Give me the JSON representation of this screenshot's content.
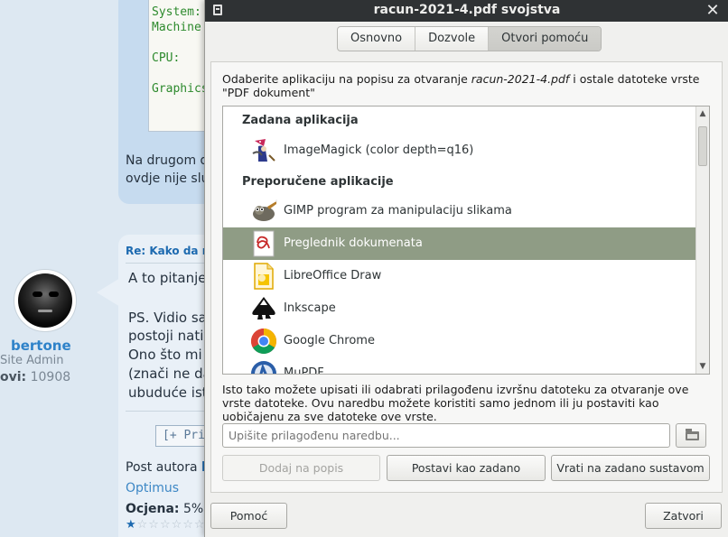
{
  "background": {
    "code_lines": [
      "System:",
      "Machine",
      "CPU:",
      "Graphics"
    ],
    "post1_lines": [
      "Na drugom di",
      "ovdje nije sluč"
    ],
    "post2_title": "Re: Kako da na",
    "post2_lines": [
      "A to pitanje",
      "PS. Vidio sa",
      "postoji nativ",
      "Ono što mi",
      "(znači ne da",
      "ubuduće ist"
    ],
    "pri_button": "[+ Pri",
    "post_author_label": "Post autora",
    "post_author_name": "b",
    "optimus": "Optimus",
    "ocjena_label": "Ocjena:",
    "ocjena_value": "5%",
    "user": {
      "name": "bertone",
      "role": "Site Admin",
      "posts_label": "ovi:",
      "posts_value": "10908"
    }
  },
  "dialog": {
    "title": "racun-2021-4.pdf svojstva",
    "tabs": [
      {
        "label": "Osnovno",
        "active": false
      },
      {
        "label": "Dozvole",
        "active": false
      },
      {
        "label": "Otvori pomoću",
        "active": true
      }
    ],
    "description_prefix": "Odaberite aplikaciju na popisu za otvaranje ",
    "description_file": "racun-2021-4.pdf",
    "description_suffix": " i ostale datoteke vrste \"PDF dokument\"",
    "default_heading": "Zadana aplikacija",
    "recommended_heading": "Preporučene aplikacije",
    "default_app": {
      "label": "ImageMagick (color depth=q16)",
      "icon": "imagemagick-icon"
    },
    "apps": [
      {
        "label": "GIMP program za manipulaciju slikama",
        "icon": "gimp-icon",
        "selected": false
      },
      {
        "label": "Preglednik dokumenata",
        "icon": "document-viewer-icon",
        "selected": true
      },
      {
        "label": "LibreOffice Draw",
        "icon": "libreoffice-draw-icon",
        "selected": false
      },
      {
        "label": "Inkscape",
        "icon": "inkscape-icon",
        "selected": false
      },
      {
        "label": "Google Chrome",
        "icon": "google-chrome-icon",
        "selected": false
      },
      {
        "label": "MuPDF",
        "icon": "mupdf-icon",
        "selected": false
      }
    ],
    "hint": "Isto tako možete upisati ili odabrati prilagođenu izvršnu datoteku za otvaranje ove vrste datoteke.  Ovu naredbu možete koristiti samo jednom ili ju postaviti kao uobičajenu za sve datoteke ove vrste.",
    "command_placeholder": "Upišite prilagođenu naredbu...",
    "buttons": {
      "add": "Dodaj na popis",
      "set_default": "Postavi kao zadano",
      "reset": "Vrati na zadano sustavom",
      "help": "Pomoć",
      "close": "Zatvori"
    },
    "colors": {
      "titlebar": "#2f3234",
      "selection": "#8f9c85"
    }
  }
}
